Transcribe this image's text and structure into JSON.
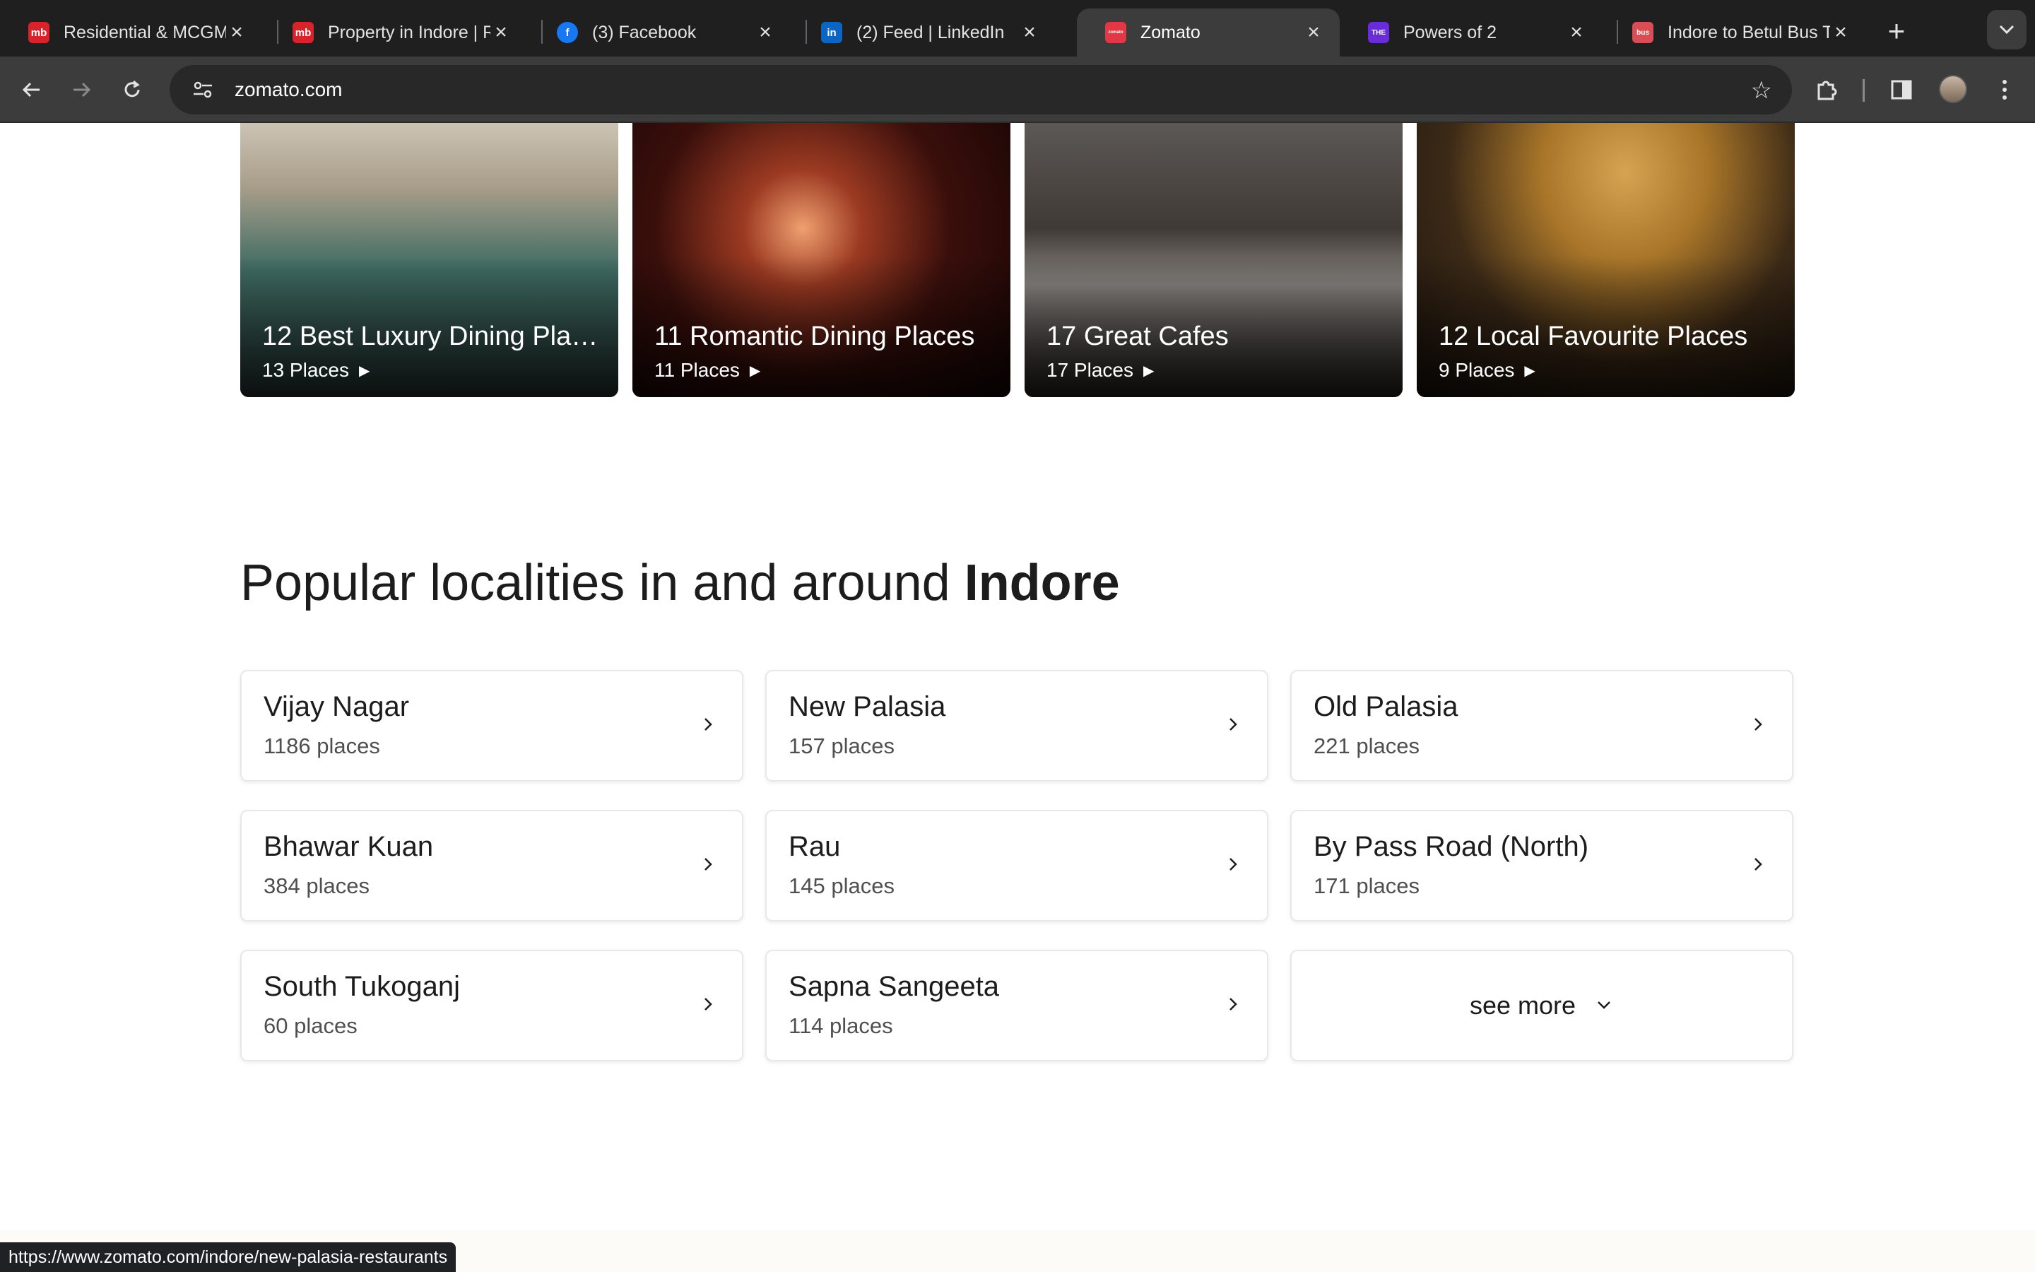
{
  "browser": {
    "tabs": [
      {
        "title": "Residential & MCGM",
        "favicon_text": "mb",
        "favicon_color": "#d8232a"
      },
      {
        "title": "Property in Indore | R",
        "favicon_text": "mb",
        "favicon_color": "#d8232a"
      },
      {
        "title": "(3) Facebook",
        "favicon_text": "f",
        "favicon_color": "#1877f2"
      },
      {
        "title": "(2) Feed | LinkedIn",
        "favicon_text": "in",
        "favicon_color": "#0a66c2"
      },
      {
        "title": "Zomato",
        "favicon_text": "zomato",
        "favicon_color": "#e23744",
        "active": true
      },
      {
        "title": "Powers of 2",
        "favicon_text": "THE",
        "favicon_color": "#6a2bd9"
      },
      {
        "title": "Indore to Betul Bus T",
        "favicon_text": "bus",
        "favicon_color": "#d84e55"
      }
    ],
    "url": "zomato.com",
    "status_url": "https://www.zomato.com/indore/new-palasia-restaurants"
  },
  "collections": [
    {
      "title": "12 Best Luxury Dining Plac...",
      "count": "13 Places"
    },
    {
      "title": "11 Romantic Dining Places",
      "count": "11 Places"
    },
    {
      "title": "17 Great Cafes",
      "count": "17 Places"
    },
    {
      "title": "12 Local Favourite Places",
      "count": "9 Places"
    }
  ],
  "localities": {
    "heading": "Popular localities in and around",
    "city": "Indore",
    "items": [
      {
        "name": "Vijay Nagar",
        "count": "1186 places"
      },
      {
        "name": "New Palasia",
        "count": "157 places"
      },
      {
        "name": "Old Palasia",
        "count": "221 places"
      },
      {
        "name": "Bhawar Kuan",
        "count": "384 places"
      },
      {
        "name": "Rau",
        "count": "145 places"
      },
      {
        "name": "By Pass Road (North)",
        "count": "171 places"
      },
      {
        "name": "South Tukoganj",
        "count": "60 places"
      },
      {
        "name": "Sapna Sangeeta",
        "count": "114 places"
      }
    ],
    "see_more_label": "see more"
  }
}
